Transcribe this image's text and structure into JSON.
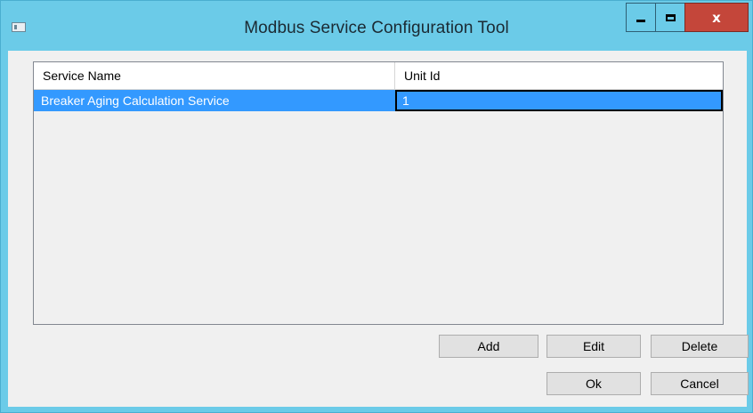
{
  "window": {
    "title": "Modbus Service Configuration Tool",
    "icons": {
      "app": "app-window-icon",
      "minimize": "minimize-icon",
      "maximize": "maximize-icon",
      "close": "close-icon"
    },
    "close_glyph": "x",
    "colors": {
      "frame": "#6bcbe8",
      "close_button": "#c4463a",
      "selection": "#3399ff"
    }
  },
  "grid": {
    "columns": [
      "Service Name",
      "Unit Id"
    ],
    "rows": [
      {
        "service_name": "Breaker Aging Calculation Service",
        "unit_id": "1",
        "selected": true
      }
    ]
  },
  "buttons": {
    "add": "Add",
    "edit": "Edit",
    "delete": "Delete",
    "ok": "Ok",
    "cancel": "Cancel"
  }
}
